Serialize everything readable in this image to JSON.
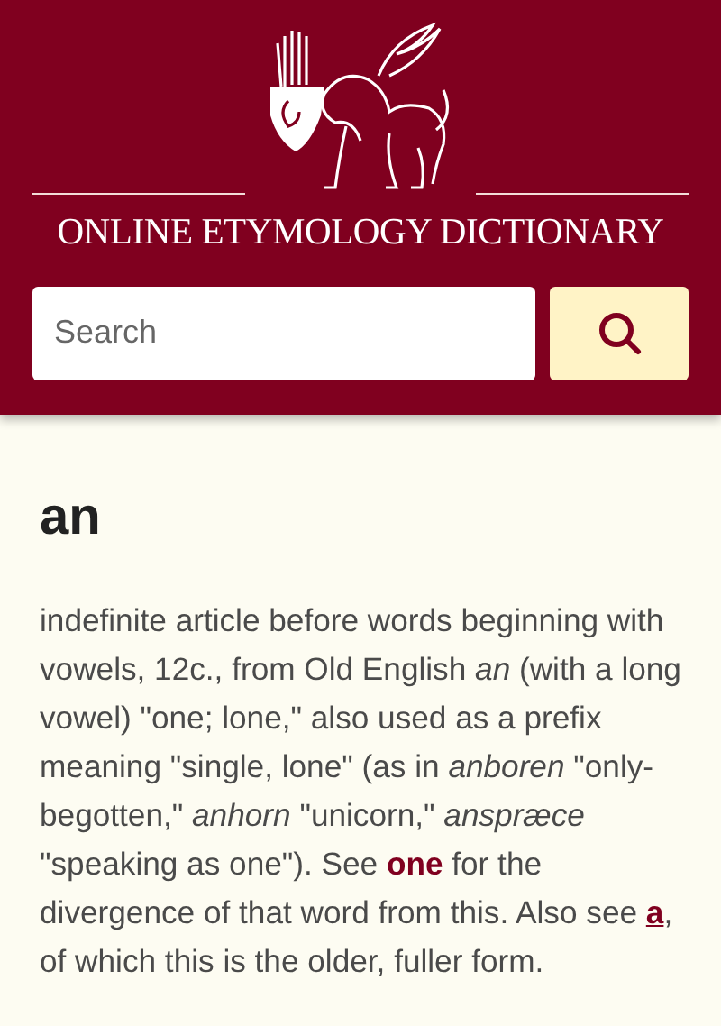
{
  "header": {
    "site_title": "ONLINE ETYMOLOGY DICTIONARY"
  },
  "search": {
    "placeholder": "Search"
  },
  "entry": {
    "word": "an",
    "parts": [
      {
        "kind": "text",
        "text": "indefinite article before words beginning with vowels, 12c., from Old English *an* (with a long vowel) \"one; lone,\" also used as a prefix meaning \"single, lone\" (as in *anboren* \"only-begotten,\" *anhorn* \"unicorn,\" *anspræce* \"speaking as one\"). See "
      },
      {
        "kind": "link",
        "text": "one",
        "underlined": false
      },
      {
        "kind": "text",
        "text": " for the divergence of that word from this. Also see "
      },
      {
        "kind": "link",
        "text": "a",
        "underlined": true
      },
      {
        "kind": "text",
        "text": ", of which this is the older, fuller form."
      }
    ]
  }
}
